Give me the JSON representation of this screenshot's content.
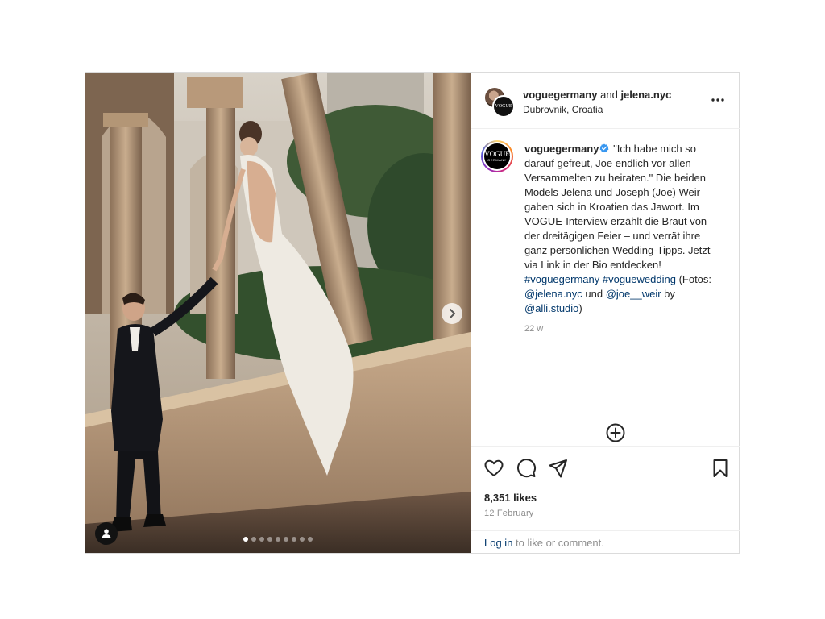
{
  "header": {
    "user1": "voguegermany",
    "and_text": "and",
    "user2": "jelena.nyc",
    "location": "Dubrovnik, Croatia",
    "avatar_logo_text": "VOGUE"
  },
  "caption": {
    "username": "voguegermany",
    "avatar_logo_line1": "VOGUE",
    "avatar_logo_line2": "GERMANY",
    "body": "\"Ich habe mich so darauf gefreut, Joe endlich vor allen Versammelten zu heiraten.\" Die beiden Models Jelena und Joseph (Joe) Weir gaben sich in Kroatien das Jawort. Im VOGUE-Interview erzählt die Braut von der dreitägigen Feier – und verrät ihre ganz persönlichen Wedding-Tipps. Jetzt via Link in der Bio entdecken!",
    "hashtag1": "#voguegermany",
    "hashtag2": "#voguewedding",
    "credit_open": "(Fotos:",
    "mention1": "@jelena.nyc",
    "credit_und": "und",
    "mention2": "@joe__weir",
    "credit_by": "by",
    "mention3": "@alli.studio",
    "credit_close": ")",
    "time_ago": "22 w"
  },
  "icons": {
    "more": "more-options-icon",
    "verified": "verified-badge-icon",
    "add": "add-circle-icon",
    "like": "heart-icon",
    "comment": "comment-icon",
    "share": "share-icon",
    "save": "bookmark-icon",
    "next": "chevron-right-icon",
    "tag": "person-tag-icon"
  },
  "carousel": {
    "total": 9,
    "active": 1
  },
  "stats": {
    "likes": "8,351 likes",
    "date": "12 February"
  },
  "footer": {
    "login_link": "Log in",
    "login_rest": " to like or comment."
  },
  "colors": {
    "link": "#00376b",
    "verified": "#3897f0",
    "muted": "#8e8e8e",
    "text": "#262626"
  }
}
